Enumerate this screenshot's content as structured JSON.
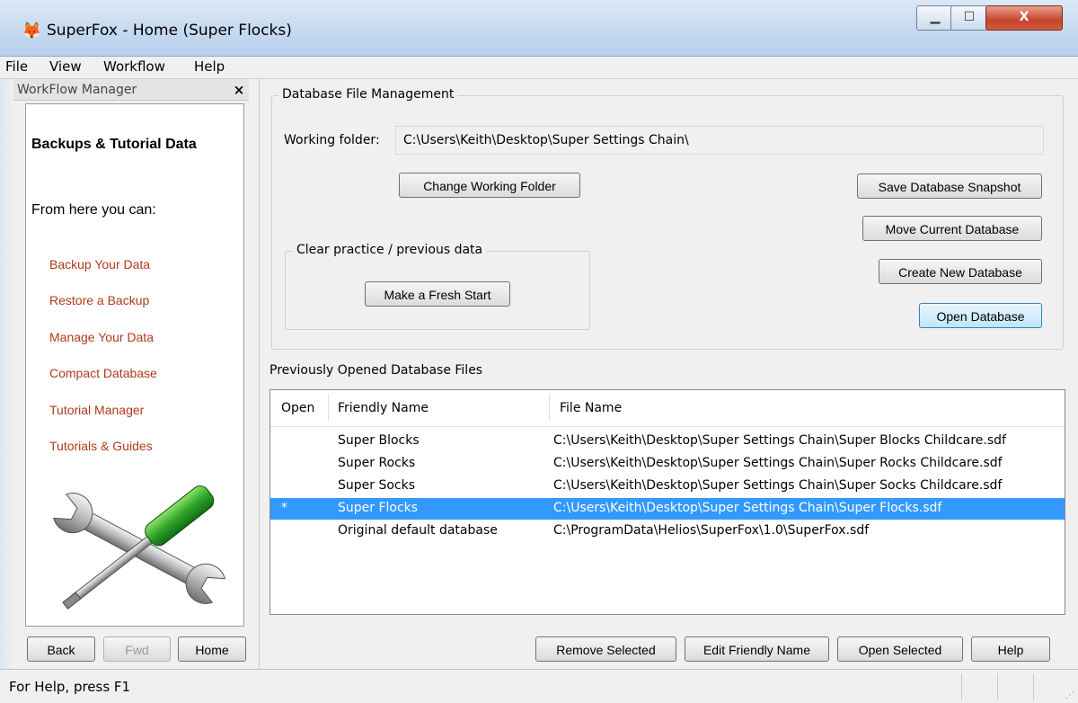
{
  "window": {
    "title": "SuperFox - Home (Super Flocks)",
    "app_icon": "fox-icon",
    "minimize_glyph": "▁",
    "maximize_glyph": "☐",
    "close_glyph": "X"
  },
  "menu": [
    "File",
    "View",
    "Workflow",
    "Help"
  ],
  "sidebar": {
    "header": "WorkFlow Manager",
    "close_glyph": "×",
    "title": "Backups & Tutorial Data",
    "subtitle": "From here you can:",
    "links": [
      "Backup Your Data",
      "Restore a Backup",
      "Manage Your Data",
      "Compact Database",
      "Tutorial Manager",
      "Tutorials & Guides"
    ],
    "illustration": "wrench-screwdriver-icon",
    "nav": {
      "back": "Back",
      "fwd": "Fwd",
      "home": "Home"
    }
  },
  "db_mgmt": {
    "group_label": "Database File Management",
    "working_folder_label": "Working folder:",
    "working_folder_value": "C:\\Users\\Keith\\Desktop\\Super Settings Chain\\",
    "change_folder": "Change Working Folder",
    "clear_group_label": "Clear practice / previous data",
    "fresh_start": "Make a Fresh Start",
    "save_snapshot": "Save Database Snapshot",
    "move_db": "Move Current Database",
    "create_db": "Create New Database",
    "open_db": "Open Database"
  },
  "previous": {
    "label": "Previously Opened Database Files",
    "columns": [
      "Open",
      "Friendly Name",
      "File Name"
    ],
    "rows": [
      {
        "open": "",
        "friendly": "Super Blocks",
        "file": "C:\\Users\\Keith\\Desktop\\Super Settings Chain\\Super Blocks Childcare.sdf"
      },
      {
        "open": "",
        "friendly": "Super Rocks",
        "file": "C:\\Users\\Keith\\Desktop\\Super Settings Chain\\Super Rocks Childcare.sdf"
      },
      {
        "open": "",
        "friendly": "Super Socks",
        "file": "C:\\Users\\Keith\\Desktop\\Super Settings Chain\\Super Socks Childcare.sdf"
      },
      {
        "open": "*",
        "friendly": "Super Flocks",
        "file": "C:\\Users\\Keith\\Desktop\\Super Settings Chain\\Super Flocks.sdf"
      },
      {
        "open": "",
        "friendly": "Original default database",
        "file": "C:\\ProgramData\\Helios\\SuperFox\\1.0\\SuperFox.sdf"
      }
    ],
    "selected_row": 3
  },
  "actions": {
    "remove": "Remove Selected",
    "edit": "Edit Friendly Name",
    "open": "Open Selected",
    "help": "Help"
  },
  "status": {
    "text": "For Help, press F1"
  },
  "colors": {
    "link": "#b03a1a",
    "selection": "#3399ff"
  }
}
